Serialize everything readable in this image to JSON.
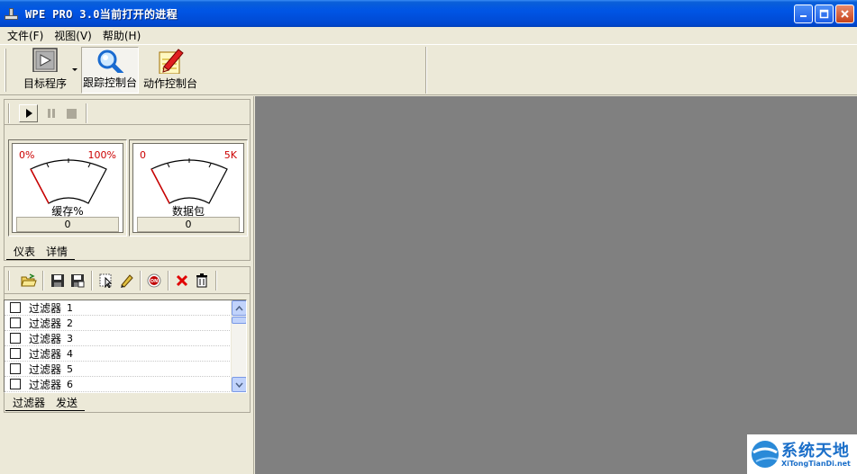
{
  "window": {
    "title": "WPE PRO 3.0当前打开的进程"
  },
  "menu": {
    "items": [
      "文件(F)",
      "视图(V)",
      "帮助(H)"
    ]
  },
  "toolbar": {
    "target_label": "目标程序",
    "trace_label": "跟踪控制台",
    "action_label": "动作控制台"
  },
  "gauges": [
    {
      "min": "0%",
      "max": "100%",
      "label": "缓存%",
      "value": "0"
    },
    {
      "min": "0",
      "max": "5K",
      "label": "数据包",
      "value": "0"
    }
  ],
  "meter_tabs": [
    "仪表",
    "详情"
  ],
  "filters": [
    {
      "label": "过滤器",
      "num": "1",
      "checked": false
    },
    {
      "label": "过滤器",
      "num": "2",
      "checked": false
    },
    {
      "label": "过滤器",
      "num": "3",
      "checked": false
    },
    {
      "label": "过滤器",
      "num": "4",
      "checked": false
    },
    {
      "label": "过滤器",
      "num": "5",
      "checked": false
    },
    {
      "label": "过滤器",
      "num": "6",
      "checked": false
    }
  ],
  "filter_tabs": [
    "过滤器",
    "发送"
  ],
  "watermark": {
    "title": "系统天地",
    "subtitle": "XiTongTianDi.net"
  }
}
